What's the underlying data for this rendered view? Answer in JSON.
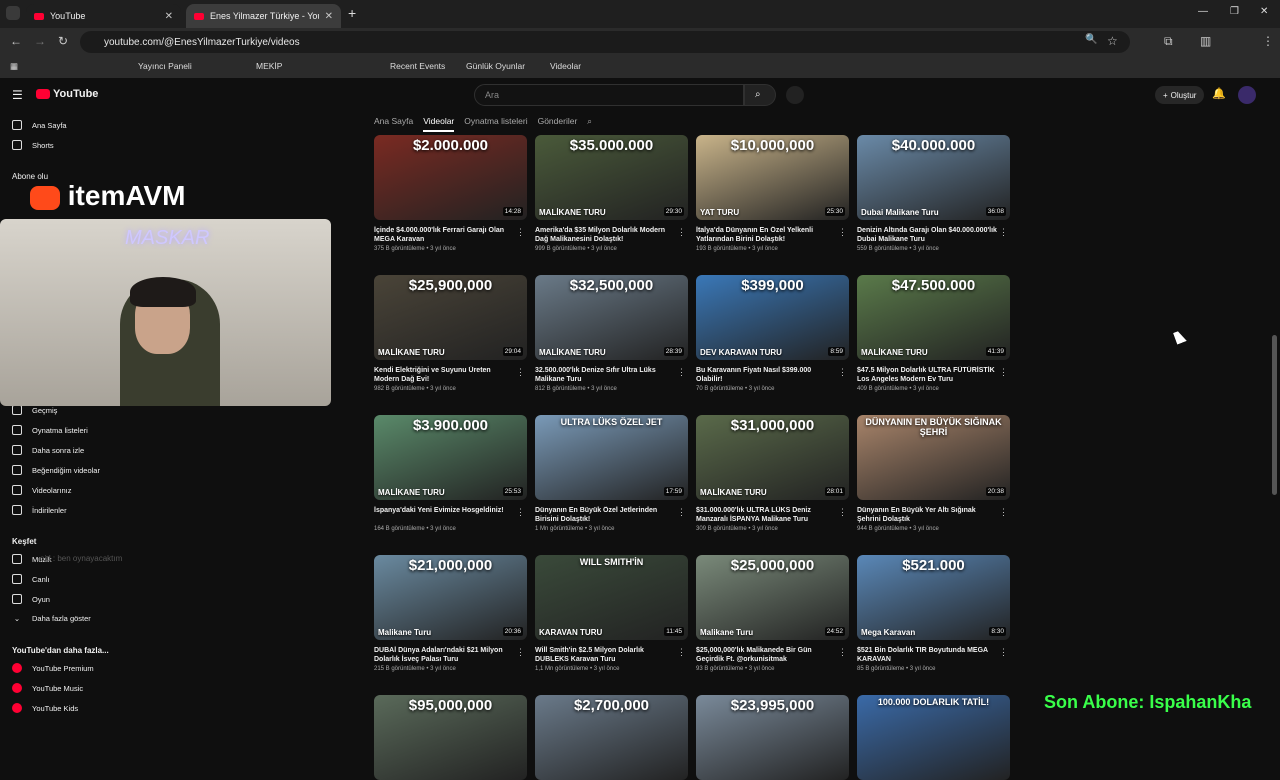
{
  "browser": {
    "tabs": [
      {
        "label": "YouTube"
      },
      {
        "label": "Enes Yilmazer Türkiye - YouTub"
      }
    ],
    "url": "youtube.com/@EnesYilmazerTurkiye/videos",
    "bookmarks": [
      "Yayıncı Paneli",
      "MEKİP",
      "Recent Events",
      "Günlük Oyunlar",
      "Videolar"
    ]
  },
  "youtube": {
    "logo": "YouTube",
    "search_placeholder": "Ara",
    "create_label": "Oluştur",
    "channel_tabs": [
      "Ana Sayfa",
      "Videolar",
      "Oynatma listeleri",
      "Gönderiler"
    ],
    "active_tab": "Videolar"
  },
  "sidebar": {
    "top": [
      "Ana Sayfa",
      "Shorts"
    ],
    "subs_head": "Abone olu",
    "library": [
      "Geçmiş",
      "Oynatma listeleri",
      "Daha sonra izle",
      "Beğendiğim videolar",
      "Videolarınız",
      "İndirilenler"
    ],
    "explore_head": "Keşfet",
    "explore": [
      "Müzik",
      "Canlı",
      "Oyun",
      "Daha fazla göster"
    ],
    "more_head": "YouTube'dan daha fazla...",
    "more": [
      "YouTube Premium",
      "YouTube Music",
      "YouTube Kids"
    ]
  },
  "videos": [
    {
      "price": "$2.000.000",
      "tag": "",
      "dur": "14:28",
      "title": "İçinde $4.000.000'lık Ferrari Garajı Olan MEGA Karavan",
      "meta": "375 B görüntüleme • 3 yıl önce",
      "bg": "#7a2a22"
    },
    {
      "price": "$35.000.000",
      "tag": "MALİKANE TURU",
      "dur": "29:30",
      "title": "Amerika'da $35 Milyon Dolarlık Modern Dağ Malikanesini Dolaştık!",
      "meta": "999 B görüntüleme • 3 yıl önce",
      "bg": "#4a5a3a"
    },
    {
      "price": "$10,000,000",
      "tag": "YAT TURU",
      "dur": "25:30",
      "title": "İtalya'da Dünyanın En Özel Yelkenli Yatlarından Birini Dolaştık!",
      "meta": "193 B görüntüleme • 3 yıl önce",
      "bg": "#c9b48a"
    },
    {
      "price": "$40.000.000",
      "tag": "Dubai Malikane Turu",
      "dur": "36:08",
      "title": "Denizin Altında Garajı Olan $40.000.000'lık Dubai Malikane Turu",
      "meta": "559 B görüntüleme • 3 yıl önce",
      "bg": "#6a8aa8"
    },
    {
      "price": "$25,900,000",
      "tag": "MALİKANE TURU",
      "dur": "29:04",
      "title": "Kendi Elektriğini ve Suyunu Üreten Modern Dağ Evi!",
      "meta": "982 B görüntüleme • 3 yıl önce",
      "bg": "#4a4438"
    },
    {
      "price": "$32,500,000",
      "tag": "MALİKANE TURU",
      "dur": "28:39",
      "title": "32.500.000'lık Denize Sıfır Ultra Lüks Malikane Turu",
      "meta": "812 B görüntüleme • 3 yıl önce",
      "bg": "#6a7a88"
    },
    {
      "price": "$399,000",
      "tag": "DEV KARAVAN TURU",
      "dur": "8:59",
      "title": "Bu Karavanın Fiyatı Nasıl $399.000 Olabilir!",
      "meta": "70 B görüntüleme • 3 yıl önce",
      "bg": "#3a78b8"
    },
    {
      "price": "$47.500.000",
      "tag": "MALİKANE TURU",
      "dur": "41:39",
      "title": "$47.5 Milyon Dolarlık ULTRA FÜTÜRİSTİK Los Angeles Modern Ev Turu",
      "meta": "409 B görüntüleme • 3 yıl önce",
      "bg": "#5a7a4a"
    },
    {
      "price": "$3.900.000",
      "tag": "MALİKANE TURU",
      "dur": "25:53",
      "title": "İspanya'daki Yeni Evimize Hosgeldiniz!",
      "meta": "164 B görüntüleme • 3 yıl önce",
      "bg": "#5a8a6a"
    },
    {
      "price": "ULTRA LÜKS ÖZEL JET",
      "tag": "",
      "dur": "17:59",
      "title": "Dünyanın En Büyük Özel Jetlerinden Birisini Dolaştık!",
      "meta": "1 Mn görüntüleme • 3 yıl önce",
      "bg": "#7a9ab8"
    },
    {
      "price": "$31,000,000",
      "tag": "MALİKANE TURU",
      "dur": "28:01",
      "title": "$31.000.000'lık ULTRA LÜKS Deniz Manzaralı İSPANYA Malikane Turu",
      "meta": "309 B görüntüleme • 3 yıl önce",
      "bg": "#5a6a4a"
    },
    {
      "price": "DÜNYANIN EN BÜYÜK SIĞINAK ŞEHRİ",
      "tag": "",
      "dur": "20:38",
      "title": "Dünyanın En Büyük Yer Altı Sığınak Şehrini Dolaştık",
      "meta": "944 B görüntüleme • 3 yıl önce",
      "bg": "#a8846a"
    },
    {
      "price": "$21,000,000",
      "tag": "Malikane Turu",
      "dur": "20:36",
      "title": "DUBAİ Dünya Adaları'ndaki $21 Milyon Dolarlık İsveç Palası Turu",
      "meta": "215 B görüntüleme • 3 yıl önce",
      "bg": "#6a8aa0"
    },
    {
      "price": "WILL SMITH'İN",
      "tag": "KARAVAN TURU",
      "dur": "11:45",
      "title": "Will Smith'in $2.5 Milyon Dolarlık DUBLEKS Karavan Turu",
      "meta": "1,1 Mn görüntüleme • 3 yıl önce",
      "bg": "#3a4a3a"
    },
    {
      "price": "$25,000,000",
      "tag": "Malikane Turu",
      "dur": "24:52",
      "title": "$25,000,000'lık Malikanede Bir Gün Geçirdik Ft. @orkunisitmak",
      "meta": "93 B görüntüleme • 3 yıl önce",
      "bg": "#7a8a7a"
    },
    {
      "price": "$521.000",
      "tag": "Mega Karavan",
      "dur": "8:30",
      "title": "$521 Bin Dolarlık TIR Boyutunda MEGA KARAVAN",
      "meta": "85 B görüntüleme • 3 yıl önce",
      "bg": "#5a88b8"
    },
    {
      "price": "$95,000,000",
      "tag": "",
      "dur": "",
      "title": "",
      "meta": "",
      "bg": "#5a6a5a"
    },
    {
      "price": "$2,700,000",
      "tag": "",
      "dur": "",
      "title": "",
      "meta": "",
      "bg": "#6a7a8a"
    },
    {
      "price": "$23,995,000",
      "tag": "",
      "dur": "",
      "title": "",
      "meta": "",
      "bg": "#7a8a9a"
    },
    {
      "price": "100.000 DOLARLIK TATİL!",
      "tag": "",
      "dur": "",
      "title": "",
      "meta": "",
      "bg": "#3a6aa8"
    }
  ],
  "overlay": {
    "brand": "itemAVM",
    "neon_sign": "MASKAR",
    "chat_ghost": "oid : ben oynayacaktım",
    "subscriber_text": "Son Abone: IspahanKha"
  }
}
